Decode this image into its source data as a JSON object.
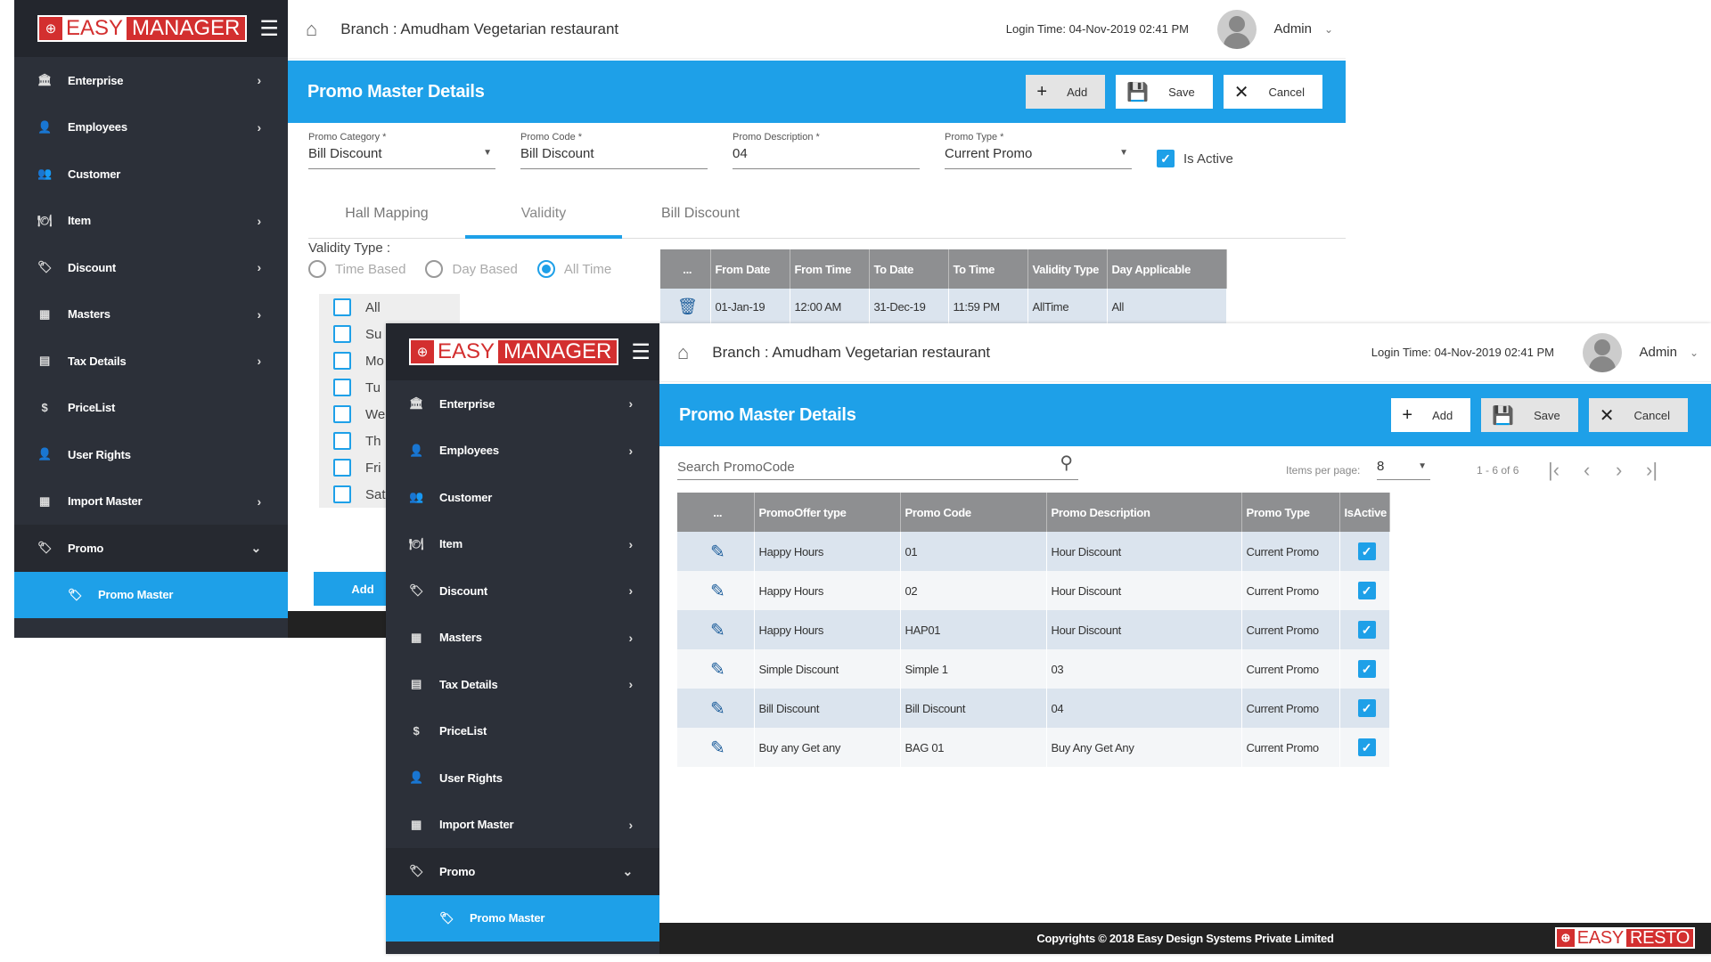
{
  "brand": {
    "globe_icon": "globe-icon",
    "easy": "EASY",
    "manager": "MANAGER",
    "hamburger_icon": "menu-icon"
  },
  "nav": [
    {
      "label": "Enterprise",
      "icon": "bank-icon",
      "glyph": "🏛",
      "arrow": "›"
    },
    {
      "label": "Employees",
      "icon": "person-icon",
      "glyph": "👤",
      "arrow": "›"
    },
    {
      "label": "Customer",
      "icon": "people-icon",
      "glyph": "👥",
      "arrow": ""
    },
    {
      "label": "Item",
      "icon": "item-icon",
      "glyph": "🍽",
      "arrow": "›"
    },
    {
      "label": "Discount",
      "icon": "tag-icon",
      "glyph": "🏷",
      "arrow": "›"
    },
    {
      "label": "Masters",
      "icon": "grid-icon",
      "glyph": "▦",
      "arrow": "›"
    },
    {
      "label": "Tax Details",
      "icon": "receipt-icon",
      "glyph": "▤",
      "arrow": "›"
    },
    {
      "label": "PriceList",
      "icon": "dollar-icon",
      "glyph": "$",
      "arrow": ""
    },
    {
      "label": "User Rights",
      "icon": "user-icon",
      "glyph": "👤",
      "arrow": ""
    },
    {
      "label": "Import Master",
      "icon": "import-icon",
      "glyph": "▦",
      "arrow": "›"
    },
    {
      "label": "Promo",
      "icon": "tag-icon",
      "glyph": "🏷",
      "arrow": "⌄"
    }
  ],
  "nav_active": {
    "label": "Promo Master",
    "icon": "tag-icon",
    "glyph": "🏷"
  },
  "header": {
    "branch": "Branch : Amudham Vegetarian restaurant",
    "login_time": "Login Time: 04-Nov-2019 02:41 PM",
    "user": "Admin",
    "chevron": "⌄"
  },
  "page": {
    "title": "Promo Master Details",
    "add": "Add",
    "save": "Save",
    "cancel": "Cancel"
  },
  "form": {
    "category_label": "Promo Category *",
    "category_value": "Bill Discount",
    "code_label": "Promo Code *",
    "code_value": "Bill Discount",
    "desc_label": "Promo Description *",
    "desc_value": "04",
    "type_label": "Promo Type *",
    "type_value": "Current Promo",
    "active_label": "Is Active",
    "active": true
  },
  "tabs": [
    "Hall Mapping",
    "Validity",
    "Bill Discount"
  ],
  "selected_tab": "Validity",
  "validity": {
    "type_label": "Validity Type :",
    "options": [
      "Time Based",
      "Day Based",
      "All Time"
    ],
    "selected": "All Time",
    "days": [
      "All",
      "Su",
      "Mo",
      "Tu",
      "We",
      "Th",
      "Fri",
      "Sat"
    ],
    "add_label": "Add",
    "columns": [
      "...",
      "From Date",
      "From Time",
      "To Date",
      "To Time",
      "Validity Type",
      "Day Applicable"
    ],
    "rows": [
      [
        "01-Jan-19",
        "12:00 AM",
        "31-Dec-19",
        "11:59 PM",
        "AllTime",
        "All"
      ]
    ]
  },
  "list": {
    "search_placeholder": "Search PromoCode",
    "items_per_page_label": "Items per page:",
    "items_per_page": "8",
    "range": "1 - 6 of 6",
    "columns": [
      "...",
      "PromoOffer type",
      "Promo Code",
      "Promo Description",
      "Promo Type",
      "IsActive"
    ],
    "rows": [
      [
        "Happy Hours",
        "01",
        "Hour Discount",
        "Current Promo"
      ],
      [
        "Happy Hours",
        "02",
        "Hour Discount",
        "Current Promo"
      ],
      [
        "Happy Hours",
        "HAP01",
        "Hour Discount",
        "Current Promo"
      ],
      [
        "Simple Discount",
        "Simple 1",
        "03",
        "Current Promo"
      ],
      [
        "Bill Discount",
        "Bill Discount",
        "04",
        "Current Promo"
      ],
      [
        "Buy any Get any",
        "BAG 01",
        "Buy Any Get Any",
        "Current Promo"
      ]
    ]
  },
  "footer": {
    "copyright": "Copyrights © 2018 Easy Design Systems Private Limited",
    "easy": "EASY",
    "resto": "RESTO"
  },
  "colors": {
    "accent": "#1ea0e8",
    "sidebar": "#2c3039",
    "brand_red": "#d32f2f"
  }
}
